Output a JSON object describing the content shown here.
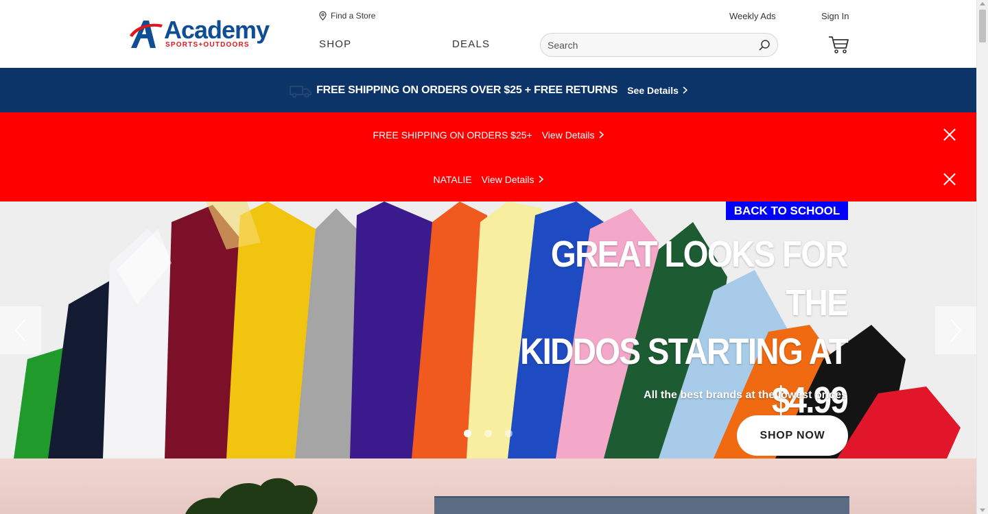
{
  "header": {
    "logo": {
      "name": "Academy",
      "tagline": "SPORTS+OUTDOORS"
    },
    "find_store": "Find a Store",
    "weekly_ads": "Weekly Ads",
    "sign_in": "Sign In",
    "nav": {
      "shop": "SHOP",
      "deals": "DEALS"
    },
    "search": {
      "placeholder": "Search"
    }
  },
  "shipping_bar": {
    "text": "FREE SHIPPING ON ORDERS OVER $25 + FREE RETURNS",
    "link": "See Details"
  },
  "promo_bars": [
    {
      "message": "FREE SHIPPING ON ORDERS $25+",
      "link": "View Details"
    },
    {
      "message": "NATALIE",
      "link": "View Details"
    }
  ],
  "hero": {
    "tag": "BACK TO SCHOOL",
    "headline_line1": "GREAT LOOKS FOR THE",
    "headline_line2": "KIDDOS STARTING AT",
    "headline_price": "$4.99",
    "subline": "All the best brands at the lowest prices",
    "cta": "SHOP NOW",
    "slides_total": 3,
    "active_slide": 1
  },
  "colors": {
    "brand_blue": "#0f4d95",
    "brand_red": "#e3141c",
    "shipping_bar": "#0c3468",
    "promo_red": "#ff0000",
    "tag_blue": "#0000ff"
  }
}
